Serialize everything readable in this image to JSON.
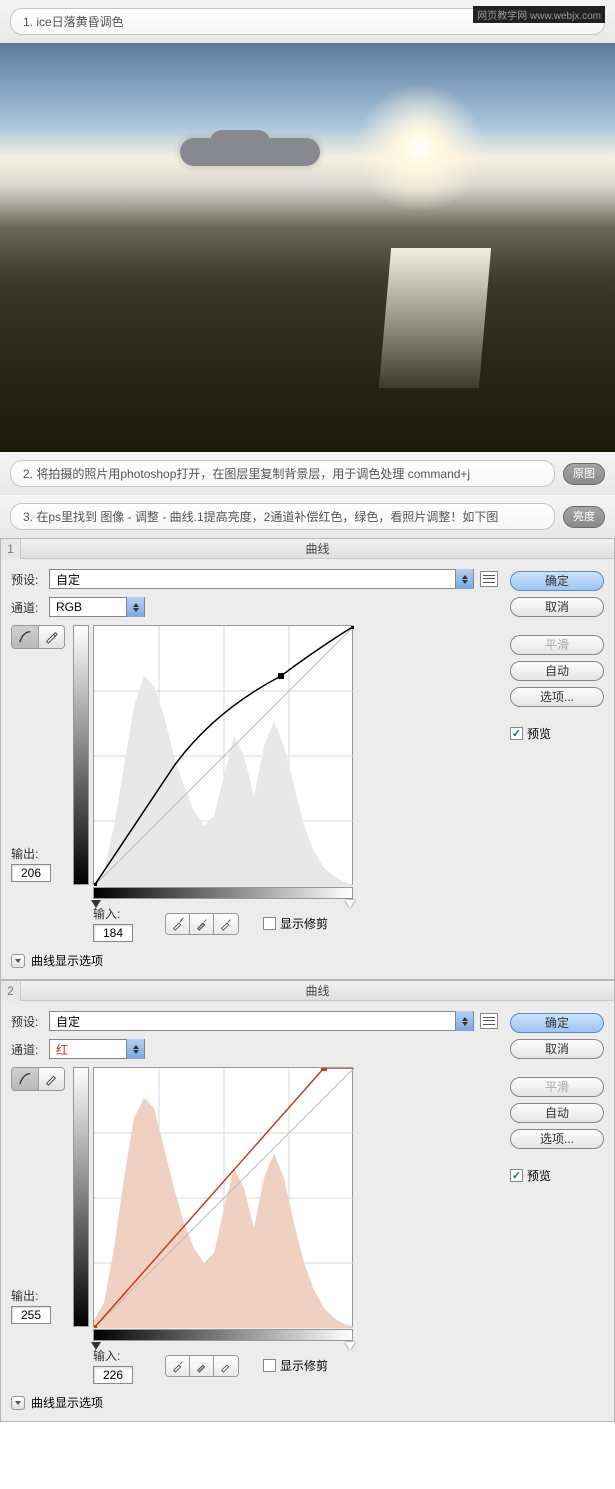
{
  "watermark": "网页教学网 www.webjx.com",
  "steps": {
    "s1": "1. ice日落黄昏调色",
    "s2": "2. 将拍摄的照片用photoshop打开，在图层里复制背景层，用于调色处理 command+j",
    "s2_btn": "原图",
    "s3": "3. 在ps里找到 图像 - 调整 - 曲线.1提高亮度，2通道补偿红色，绿色，看照片调整！如下图",
    "s3_btn": "亮度"
  },
  "dialog": {
    "title": "曲线",
    "preset_label": "预设:",
    "preset_value": "自定",
    "channel_label": "通道:",
    "output_label": "输出:",
    "input_label": "输入:",
    "show_clipping": "显示修剪",
    "curve_options": "曲线显示选项",
    "btn_ok": "确定",
    "btn_cancel": "取消",
    "btn_smooth": "平滑",
    "btn_auto": "自动",
    "btn_options": "选项...",
    "preview": "预览"
  },
  "panel1": {
    "num": "1",
    "channel": "RGB",
    "output": "206",
    "input": "184"
  },
  "panel2": {
    "num": "2",
    "channel": "红",
    "output": "255",
    "input": "226"
  },
  "chart_data": [
    {
      "type": "line",
      "title": "曲线 RGB",
      "xlabel": "输入",
      "ylabel": "输出",
      "xlim": [
        0,
        255
      ],
      "ylim": [
        0,
        255
      ],
      "series": [
        {
          "name": "curve",
          "values": [
            [
              0,
              0
            ],
            [
              60,
              90
            ],
            [
              120,
              165
            ],
            [
              184,
              206
            ],
            [
              255,
              255
            ]
          ]
        },
        {
          "name": "diagonal",
          "values": [
            [
              0,
              0
            ],
            [
              255,
              255
            ]
          ]
        }
      ],
      "histogram": [
        5,
        15,
        60,
        140,
        200,
        230,
        210,
        170,
        120,
        90,
        60,
        80,
        140,
        190,
        160,
        110,
        180,
        200,
        150,
        90,
        50,
        30,
        15,
        8,
        4,
        2
      ]
    },
    {
      "type": "line",
      "title": "曲线 红",
      "xlabel": "输入",
      "ylabel": "输出",
      "xlim": [
        0,
        255
      ],
      "ylim": [
        0,
        255
      ],
      "series": [
        {
          "name": "curve",
          "values": [
            [
              0,
              0
            ],
            [
              226,
              255
            ],
            [
              255,
              255
            ]
          ]
        },
        {
          "name": "diagonal",
          "values": [
            [
              0,
              0
            ],
            [
              255,
              255
            ]
          ]
        }
      ],
      "histogram": [
        8,
        25,
        90,
        180,
        230,
        240,
        210,
        160,
        110,
        80,
        55,
        70,
        120,
        170,
        150,
        110,
        170,
        195,
        150,
        95,
        55,
        30,
        15,
        8,
        4,
        2
      ]
    }
  ]
}
